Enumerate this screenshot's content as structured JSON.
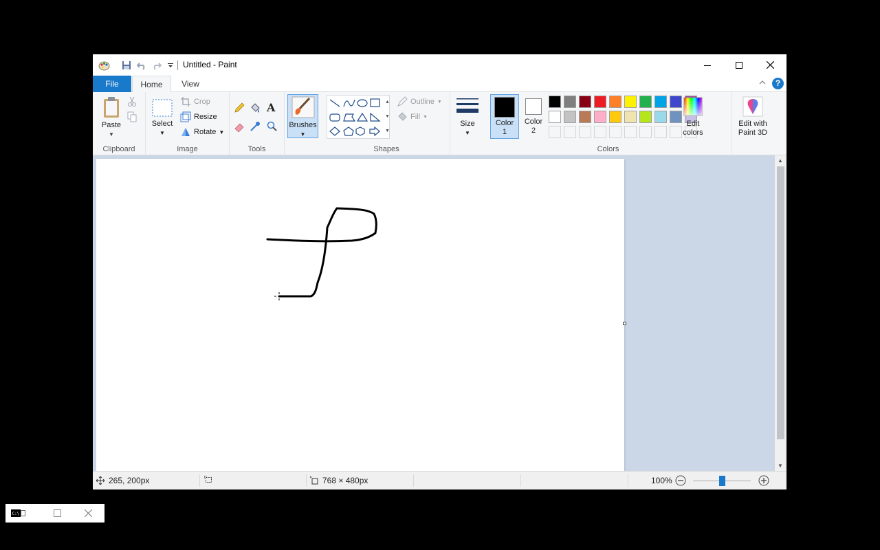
{
  "window": {
    "title": "Untitled - Paint"
  },
  "tabs": {
    "file": "File",
    "home": "Home",
    "view": "View"
  },
  "ribbon": {
    "clipboard": {
      "label": "Clipboard",
      "paste": "Paste"
    },
    "image": {
      "label": "Image",
      "select": "Select",
      "crop": "Crop",
      "resize": "Resize",
      "rotate": "Rotate"
    },
    "tools": {
      "label": "Tools"
    },
    "brushes": {
      "label": "Brushes"
    },
    "shapes": {
      "label": "Shapes",
      "outline": "Outline",
      "fill": "Fill"
    },
    "size": {
      "label": "Size"
    },
    "color1": {
      "label": "Color",
      "num": "1"
    },
    "color2": {
      "label": "Color",
      "num": "2"
    },
    "colors": {
      "label": "Colors",
      "edit_line1": "Edit",
      "edit_line2": "colors"
    },
    "paint3d": {
      "line1": "Edit with",
      "line2": "Paint 3D"
    }
  },
  "palette": {
    "row1": [
      "#000000",
      "#7f7f7f",
      "#880015",
      "#ed1c24",
      "#ff7f27",
      "#fff200",
      "#22b14c",
      "#00a2e8",
      "#3f48cc",
      "#a349a4"
    ],
    "row2": [
      "#ffffff",
      "#c3c3c3",
      "#b97a57",
      "#ffaec9",
      "#ffc90e",
      "#efe4b0",
      "#b5e61d",
      "#99d9ea",
      "#7092be",
      "#c8bfe7"
    ]
  },
  "status": {
    "cursor_pos": "265, 200px",
    "canvas_size": "768 × 480px",
    "zoom": "100%",
    "zoom_fraction": 0.5
  },
  "colors": {
    "accent": "#1979ca",
    "selected_bg": "#c9e0f7",
    "selected_border": "#62a2e4"
  }
}
